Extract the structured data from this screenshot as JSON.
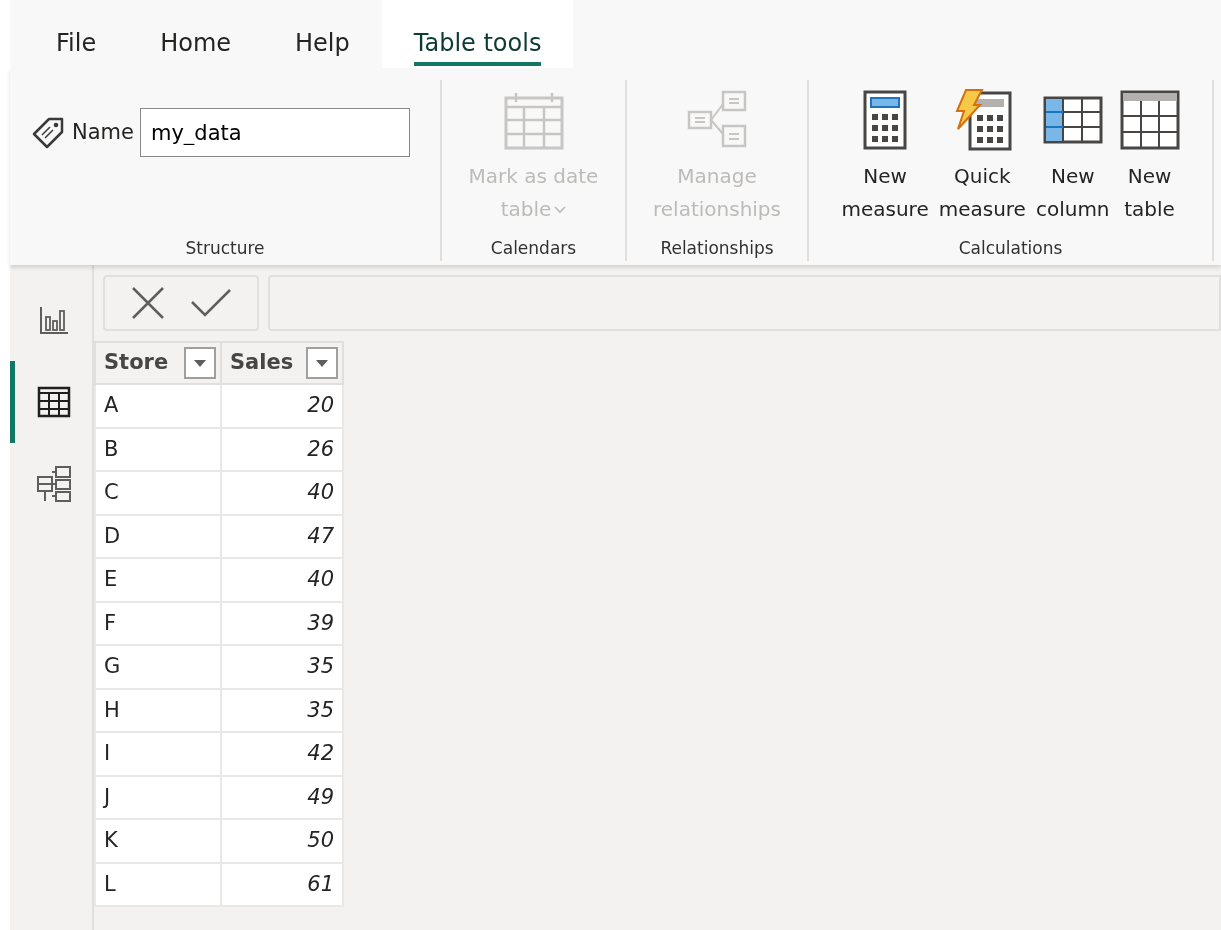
{
  "tabs": [
    {
      "label": "File",
      "selected": false
    },
    {
      "label": "Home",
      "selected": false
    },
    {
      "label": "Help",
      "selected": false
    },
    {
      "label": "Table tools",
      "selected": true
    }
  ],
  "ribbon": {
    "name_field": {
      "label": "Name",
      "value": "my_data"
    },
    "groups": [
      {
        "label": "Structure",
        "kind": "name"
      },
      {
        "label": "Calendars",
        "kind": "commands",
        "commands": [
          {
            "kind": "calendar",
            "lines": [
              "Mark as date",
              "table"
            ],
            "disabled": true,
            "dropdown": true
          }
        ]
      },
      {
        "label": "Relationships",
        "kind": "commands",
        "commands": [
          {
            "kind": "relationships",
            "lines": [
              "Manage",
              "relationships"
            ],
            "disabled": true,
            "dropdown": false
          }
        ]
      },
      {
        "label": "Calculations",
        "kind": "commands",
        "commands": [
          {
            "kind": "measure",
            "lines": [
              "New",
              "measure"
            ],
            "disabled": false,
            "dropdown": false
          },
          {
            "kind": "quick-measure",
            "lines": [
              "Quick",
              "measure"
            ],
            "disabled": false,
            "dropdown": false
          },
          {
            "kind": "column",
            "lines": [
              "New",
              "column"
            ],
            "disabled": false,
            "dropdown": false
          },
          {
            "kind": "table",
            "lines": [
              "New",
              "table"
            ],
            "disabled": false,
            "dropdown": false
          }
        ]
      }
    ]
  },
  "view_rail": [
    {
      "kind": "report",
      "selected": false
    },
    {
      "kind": "table",
      "selected": true
    },
    {
      "kind": "model",
      "selected": false
    }
  ],
  "table": {
    "columns": [
      "Store",
      "Sales"
    ],
    "rows": [
      [
        "A",
        "20"
      ],
      [
        "B",
        "26"
      ],
      [
        "C",
        "40"
      ],
      [
        "D",
        "47"
      ],
      [
        "E",
        "40"
      ],
      [
        "F",
        "39"
      ],
      [
        "G",
        "35"
      ],
      [
        "H",
        "35"
      ],
      [
        "I",
        "42"
      ],
      [
        "J",
        "49"
      ],
      [
        "K",
        "50"
      ],
      [
        "L",
        "61"
      ]
    ]
  }
}
